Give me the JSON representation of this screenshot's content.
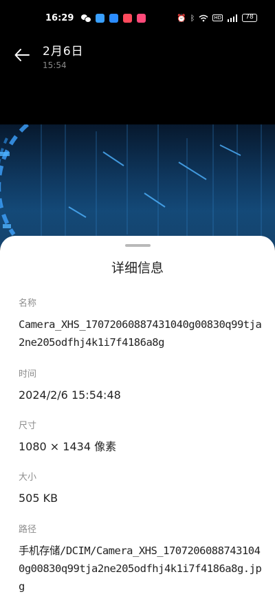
{
  "status_bar": {
    "time": "16:29",
    "battery": "78"
  },
  "header": {
    "title": "2月6日",
    "subtitle": "15:54"
  },
  "sheet": {
    "title": "详细信息",
    "name": {
      "label": "名称",
      "value": "Camera_XHS_17072060887431040g00830q99tja2ne205odfhj4k1i7f4186a8g"
    },
    "time": {
      "label": "时间",
      "value": "2024/2/6 15:54:48"
    },
    "size": {
      "label": "尺寸",
      "value": "1080 × 1434 像素"
    },
    "file_size": {
      "label": "大小",
      "value": "505 KB"
    },
    "path": {
      "label": "路径",
      "value": "手机存储/DCIM/Camera_XHS_17072060887431040g00830q99tja2ne205odfhj4k1i7f4186a8g.jpg"
    }
  },
  "colors": {
    "background": "#000000",
    "sheet": "#ffffff",
    "label": "#8c8c8c",
    "value": "#222222"
  }
}
